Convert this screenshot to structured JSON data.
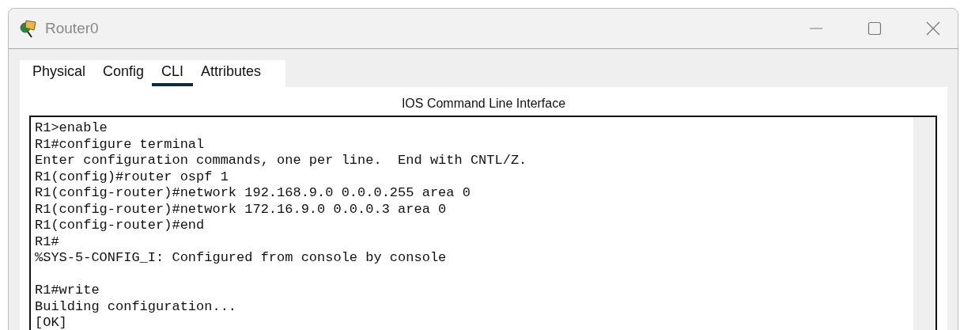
{
  "window": {
    "title": "Router0"
  },
  "tabs": [
    {
      "label": "Physical",
      "selected": false
    },
    {
      "label": "Config",
      "selected": false
    },
    {
      "label": "CLI",
      "selected": true
    },
    {
      "label": "Attributes",
      "selected": false
    }
  ],
  "panel": {
    "heading": "IOS Command Line Interface"
  },
  "terminal": {
    "output": "R1>enable\nR1#configure terminal\nEnter configuration commands, one per line.  End with CNTL/Z.\nR1(config)#router ospf 1\nR1(config-router)#network 192.168.9.0 0.0.0.255 area 0\nR1(config-router)#network 172.16.9.0 0.0.0.3 area 0\nR1(config-router)#end\nR1#\n%SYS-5-CONFIG_I: Configured from console by console\n\nR1#write\nBuilding configuration...\n[OK]"
  }
}
